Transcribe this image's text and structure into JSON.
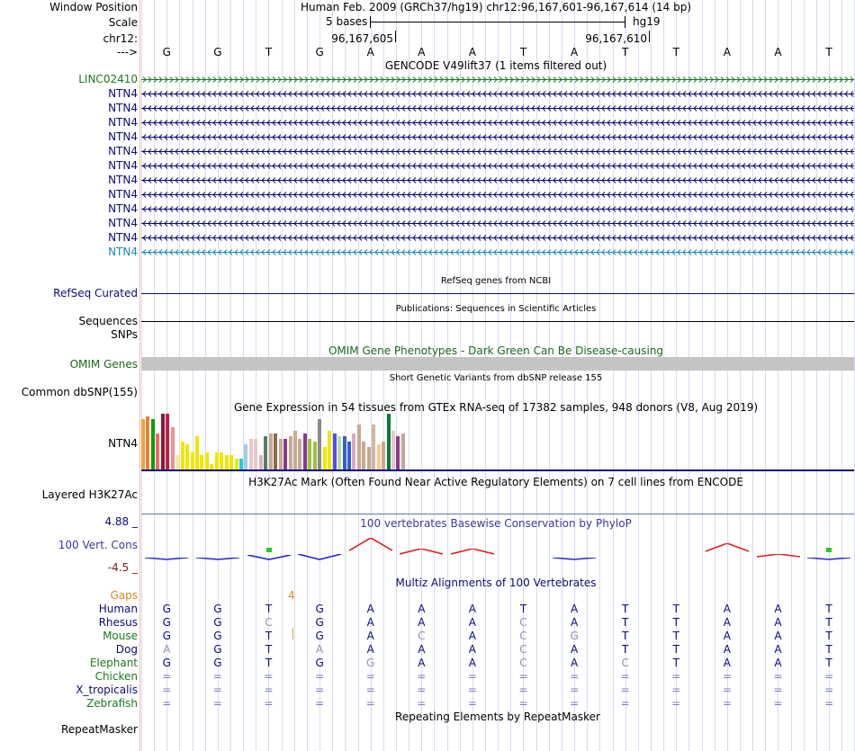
{
  "header": {
    "window_position_label": "Window Position",
    "assembly_text": "Human Feb. 2009 (GRCh37/hg19)   chr12:96,167,601-96,167,614 (14 bp)",
    "scale_label": "Scale",
    "scale_bar_text": "5 bases",
    "scale_db": "hg19",
    "chrom_label": "chr12:",
    "pos_left": "96,167,605",
    "pos_right": "96,167,610",
    "strand_label": "--->",
    "bases": [
      "G",
      "G",
      "T",
      "G",
      "A",
      "A",
      "A",
      "T",
      "A",
      "T",
      "T",
      "A",
      "A",
      "T"
    ]
  },
  "gencode": {
    "title": "GENCODE V49lift37 (1 items filtered out)",
    "items": [
      {
        "label": "LINC02410",
        "color": "#1a7a1a",
        "arrow": "right"
      },
      {
        "label": "NTN4",
        "color": "#0c0c78",
        "arrow": "left"
      },
      {
        "label": "NTN4",
        "color": "#0c0c78",
        "arrow": "left"
      },
      {
        "label": "NTN4",
        "color": "#0c0c78",
        "arrow": "left"
      },
      {
        "label": "NTN4",
        "color": "#0c0c78",
        "arrow": "left"
      },
      {
        "label": "NTN4",
        "color": "#0c0c78",
        "arrow": "left"
      },
      {
        "label": "NTN4",
        "color": "#0c0c78",
        "arrow": "left"
      },
      {
        "label": "NTN4",
        "color": "#0c0c78",
        "arrow": "left"
      },
      {
        "label": "NTN4",
        "color": "#0c0c78",
        "arrow": "left"
      },
      {
        "label": "NTN4",
        "color": "#0c0c78",
        "arrow": "left"
      },
      {
        "label": "NTN4",
        "color": "#0c0c78",
        "arrow": "left"
      },
      {
        "label": "NTN4",
        "color": "#0c0c78",
        "arrow": "left"
      },
      {
        "label": "NTN4",
        "color": "#1b87b5",
        "arrow": "left"
      }
    ]
  },
  "refseq": {
    "title": "RefSeq genes from NCBI",
    "label": "RefSeq Curated"
  },
  "publications": {
    "title": "Publications: Sequences in Scientific Articles",
    "label": "Sequences"
  },
  "snps": {
    "label": "SNPs"
  },
  "omim": {
    "title": "OMIM Gene Phenotypes - Dark Green Can Be Disease-causing",
    "label": "OMIM Genes"
  },
  "dbsnp": {
    "title": "Short Genetic Variants from dbSNP release 155",
    "label": "Common dbSNP(155)"
  },
  "gtex": {
    "title": "Gene Expression in 54 tissues from GTEx RNA-seq of 17382 samples, 948 donors (V8, Aug 2019)",
    "label": "NTN4",
    "values": [
      0.9,
      0.95,
      0.9,
      0.65,
      1.0,
      1.0,
      0.75,
      0.25,
      0.5,
      0.45,
      0.3,
      0.6,
      0.25,
      0.3,
      0.1,
      0.3,
      0.3,
      0.25,
      0.25,
      0.2,
      0.2,
      0.45,
      0.55,
      0.55,
      0.25,
      0.6,
      0.65,
      0.65,
      0.55,
      0.55,
      0.6,
      0.7,
      0.55,
      0.65,
      0.55,
      0.5,
      0.9,
      0.4,
      0.7,
      0.65,
      0.6,
      0.6,
      0.5,
      0.65,
      0.8,
      0.5,
      0.4,
      0.8,
      0.45,
      0.5,
      1.0,
      0.7,
      0.6,
      0.65
    ],
    "colors": [
      "#f4a23c",
      "#e6813c",
      "#00a000",
      "#f76464",
      "#8a1a3a",
      "#c01c4c",
      "#f09090",
      "#f4e8a0",
      "#f0e600",
      "#f0e600",
      "#f0e600",
      "#f0e600",
      "#f0e600",
      "#f0e600",
      "#f0e600",
      "#f0e600",
      "#f0e600",
      "#f0e600",
      "#f0e600",
      "#f0e600",
      "#1cd0d8",
      "#a8c8e8",
      "#e8c8c8",
      "#e8c8c8",
      "#d8b8b8",
      "#5a7a6a",
      "#c8a890",
      "#8a6a4a",
      "#c8a890",
      "#8a3a8a",
      "#c8a890",
      "#c8a890",
      "#c8a890",
      "#8a3a8a",
      "#a0c040",
      "#a0c040",
      "#8a8a8a",
      "#f0e600",
      "#f0e600",
      "#5050e8",
      "#b8d8a0",
      "#3060d0",
      "#3060d0",
      "#e0a8c0",
      "#c8a890",
      "#c8a890",
      "#c8a890",
      "#d0b8a0",
      "#f4c890",
      "#c8a890",
      "#0a7a3a",
      "#f0c0c8",
      "#8a3a8a",
      "#c8a890"
    ]
  },
  "h3k27ac": {
    "title": "H3K27Ac Mark (Often Found Near Active Regulatory Elements) on 7 cell lines from ENCODE",
    "label": "Layered H3K27Ac"
  },
  "phylop": {
    "title": "100 vertebrates Basewise Conservation by PhyloP",
    "label": "100 Vert. Cons",
    "ymax": "4.88 _",
    "ymin": "-4.5 _",
    "values": [
      -0.2,
      -0.3,
      -0.7,
      -0.9,
      2.0,
      0.8,
      0.9,
      0.0,
      -0.1,
      0.0,
      0.0,
      1.3,
      0.4,
      -0.3
    ]
  },
  "multiz": {
    "title": "Multiz Alignments of 100 Vertebrates",
    "gaps_label": "Gaps",
    "gaps_value": "4",
    "species": [
      {
        "label": "Human",
        "color": "#0c0c78",
        "bases": [
          "G",
          "G",
          "T",
          "G",
          "A",
          "A",
          "A",
          "T",
          "A",
          "T",
          "T",
          "A",
          "A",
          "T"
        ]
      },
      {
        "label": "Rhesus",
        "color": "#0c0c78",
        "bases": [
          "G",
          "G",
          "C",
          "G",
          "A",
          "A",
          "A",
          "C",
          "A",
          "T",
          "T",
          "A",
          "A",
          "T"
        ]
      },
      {
        "label": "Mouse",
        "color": "#1a7a1a",
        "bases": [
          "G",
          "G",
          "T",
          "G",
          "A",
          "C",
          "A",
          "C",
          "G",
          "T",
          "T",
          "A",
          "A",
          "T"
        ]
      },
      {
        "label": "Dog",
        "color": "#0c0c78",
        "bases": [
          "A",
          "G",
          "T",
          "A",
          "A",
          "A",
          "A",
          "C",
          "A",
          "T",
          "T",
          "A",
          "A",
          "T"
        ]
      },
      {
        "label": "Elephant",
        "color": "#1a7a1a",
        "bases": [
          "G",
          "G",
          "T",
          "G",
          "G",
          "A",
          "A",
          "C",
          "A",
          "C",
          "T",
          "A",
          "A",
          "T"
        ]
      },
      {
        "label": "Chicken",
        "color": "#1a7a1a",
        "bases": [
          "=",
          "=",
          "=",
          "=",
          "=",
          "=",
          "=",
          "=",
          "=",
          "=",
          "=",
          "=",
          "=",
          "="
        ]
      },
      {
        "label": "X_tropicalis",
        "color": "#0c0c78",
        "bases": [
          "=",
          "=",
          "=",
          "=",
          "=",
          "=",
          "=",
          "=",
          "=",
          "=",
          "=",
          "=",
          "=",
          "="
        ]
      },
      {
        "label": "Zebrafish",
        "color": "#1a7a1a",
        "bases": [
          "=",
          "=",
          "=",
          "=",
          "=",
          "=",
          "=",
          "=",
          "=",
          "=",
          "=",
          "=",
          "=",
          "="
        ]
      }
    ]
  },
  "repeatmasker": {
    "title": "Repeating Elements by RepeatMasker",
    "label": "RepeatMasker"
  }
}
